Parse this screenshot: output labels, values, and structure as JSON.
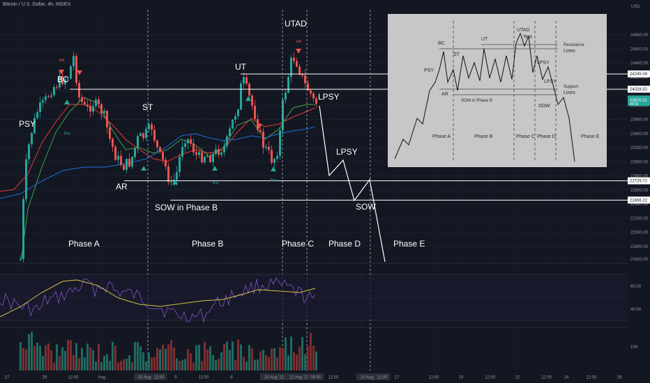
{
  "header": {
    "title": "Bitcoin / U.S. Dollar, 4h, INDEX"
  },
  "chart_data": {
    "type": "candlestick",
    "title": "Bitcoin / U.S. Dollar, 4h, INDEX",
    "y_unit": "USD",
    "y_ticks": [
      24800,
      24600,
      24400,
      24200,
      24000,
      23800,
      23600,
      23400,
      23200,
      23000,
      22800,
      22600,
      22400,
      22200,
      22000,
      21800,
      21620
    ],
    "price_labels": [
      {
        "label": "24245.04",
        "value": 24245.04,
        "color": "#ffffff"
      },
      {
        "label": "24028.52",
        "value": 24028.52,
        "color": "#ffffff"
      },
      {
        "label": "23870.31",
        "sub": "46:52",
        "value": 23870.31,
        "color": "#26a69a"
      },
      {
        "label": "22729.72",
        "value": 22729.72,
        "color": "#ffffff"
      },
      {
        "label": "22456.22",
        "value": 22456.22,
        "color": "#ffffff"
      }
    ],
    "x_ticks": [
      "27",
      "29",
      "12:00",
      "Aug",
      "03 Aug '22",
      "12:00",
      "5",
      "12:00",
      "8",
      "10 Aug '22",
      "12 Aug '22",
      "00:00",
      "12:00",
      "15 Aug '22",
      "12:00",
      "17",
      "12:00",
      "19",
      "12:00",
      "22",
      "12:00",
      "24",
      "12:00",
      "26",
      "12:00",
      "29"
    ],
    "highlighted_x_ticks": [
      "03 Aug '22",
      "12:00",
      "10 Aug '22",
      "12 Aug '22",
      "00:00",
      "15 Aug '22",
      "12:00"
    ],
    "wyckoff_labels": [
      "PSY",
      "BC",
      "AR",
      "ST",
      "SOW in Phase B",
      "UT",
      "UTAD",
      "LPSY",
      "LPSY",
      "SOW"
    ],
    "phase_labels": [
      "Phase A",
      "Phase B",
      "Phase C",
      "Phase D",
      "Phase E"
    ],
    "signal_labels": [
      "Buy",
      "Buy",
      "Buy",
      "Sell",
      "Sell"
    ],
    "levels": [
      24245.04,
      24028.52,
      22729.72,
      22456.22
    ],
    "projection_path": [
      {
        "x": "12 Aug '22 00:00",
        "y": 23850
      },
      {
        "x": "12 Aug '22 12:00",
        "y": 22750
      },
      {
        "x": "13 Aug '22 00:00",
        "y": 23030
      },
      {
        "x": "13 Aug '22 16:00",
        "y": 22450
      },
      {
        "x": "14 Aug '22 08:00",
        "y": 22720
      },
      {
        "x": "16 Aug '22 04:00",
        "y": 21620
      }
    ],
    "rsi": {
      "ticks": [
        60.0,
        40.0
      ]
    },
    "volume": {
      "ticks": [
        "10K"
      ]
    },
    "inset": {
      "labels": [
        "BC",
        "ST",
        "UT",
        "UTAD",
        "Test",
        "Resistance",
        "Lines",
        "PSY",
        "AR",
        "SOW in Phase B",
        "LPSY",
        "LPSY",
        "Support",
        "Lines",
        "SOW"
      ],
      "phases": [
        "Phase A",
        "Phase B",
        "Phase C",
        "Phase D",
        "Phase E"
      ]
    },
    "colors": {
      "background": "#131722",
      "up": "#26a69a",
      "down": "#ef5350",
      "ma_red": "#e53935",
      "ma_green": "#43a047",
      "ma_blue": "#1e6fd9",
      "rsi_line": "#7e57c2",
      "rsi_ma": "#d4c342",
      "level_line": "#ffffff"
    }
  }
}
